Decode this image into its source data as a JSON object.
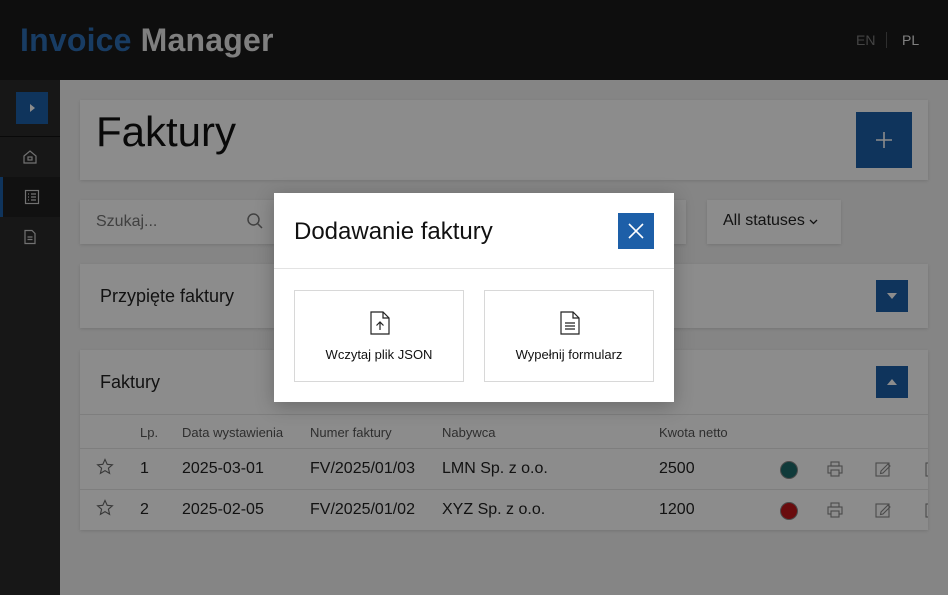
{
  "header": {
    "brand_part1": "Invoice",
    "brand_part2": "Manager",
    "languages": [
      {
        "label": "EN",
        "active": false
      },
      {
        "label": "PL",
        "active": true
      }
    ]
  },
  "sidebar": {
    "items": [
      {
        "icon": "home-icon",
        "active": false
      },
      {
        "icon": "list-icon",
        "active": true
      },
      {
        "icon": "document-icon",
        "active": false
      }
    ]
  },
  "page": {
    "title": "Faktury",
    "add_button_icon": "plus-icon"
  },
  "filters": {
    "search_placeholder": "Szukaj...",
    "status_select": "All statuses"
  },
  "pinned": {
    "title": "Przypięte faktury",
    "toggle_icon": "caret-down-icon"
  },
  "invoices": {
    "title": "Faktury",
    "toggle_icon": "caret-up-icon",
    "columns": [
      "Lp.",
      "Data wystawienia",
      "Numer faktury",
      "Nabywca",
      "Kwota netto"
    ],
    "rows": [
      {
        "lp": "1",
        "date": "2025-03-01",
        "number": "FV/2025/01/03",
        "buyer": "LMN Sp. z o.o.",
        "amount": "2500",
        "status_color": "#1e6b6b"
      },
      {
        "lp": "2",
        "date": "2025-02-05",
        "number": "FV/2025/01/02",
        "buyer": "XYZ Sp. z o.o.",
        "amount": "1200",
        "status_color": "#c0161a"
      }
    ]
  },
  "modal": {
    "title": "Dodawanie faktury",
    "options": [
      {
        "label": "Wczytaj plik JSON",
        "icon": "file-upload-icon"
      },
      {
        "label": "Wypełnij formularz",
        "icon": "file-form-icon"
      }
    ]
  },
  "colors": {
    "accent": "#1d5fa8",
    "topbar": "#1a1a1a",
    "sidebar": "#2a2a2a"
  }
}
